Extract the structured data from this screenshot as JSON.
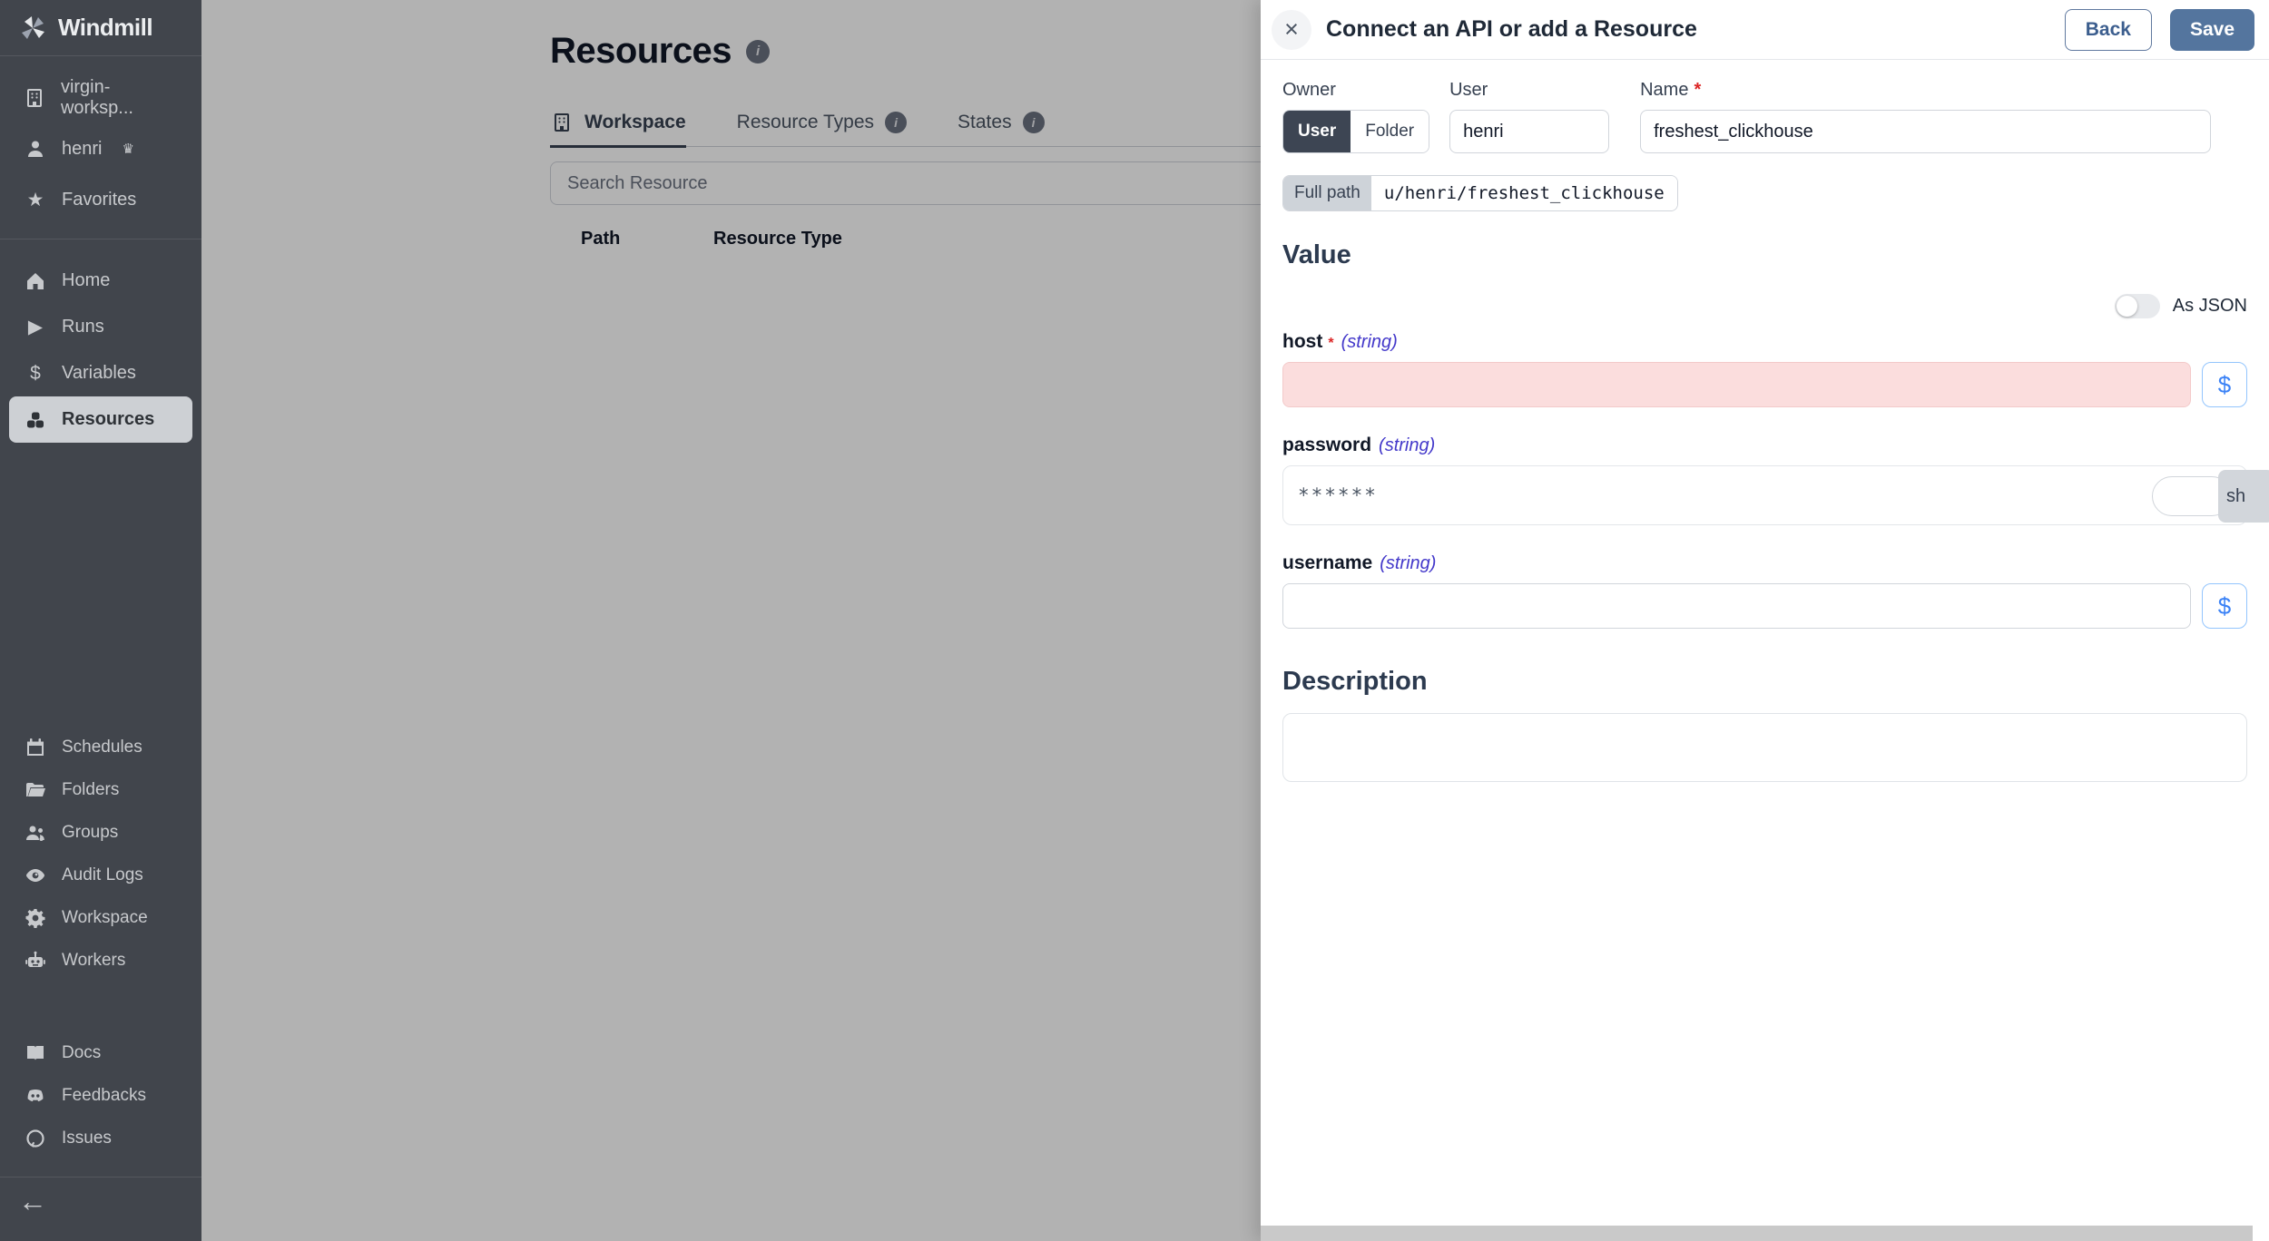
{
  "icons": {
    "close": "×",
    "crown": "♛",
    "star": "★",
    "play": "▶",
    "dollar": "$",
    "arrow_left": "←",
    "info": "i"
  },
  "sidebar": {
    "brand": "Windmill",
    "workspace": "virgin-worksp...",
    "user": "henri",
    "favorites": "Favorites",
    "nav": [
      "Home",
      "Runs",
      "Variables",
      "Resources"
    ],
    "admin": [
      "Schedules",
      "Folders",
      "Groups",
      "Audit Logs",
      "Workspace",
      "Workers"
    ],
    "links": [
      "Docs",
      "Feedbacks",
      "Issues"
    ]
  },
  "main": {
    "title": "Resources",
    "tabs": [
      "Workspace",
      "Resource Types",
      "States"
    ],
    "search_placeholder": "Search Resource",
    "columns": [
      "Path",
      "Resource Type"
    ]
  },
  "drawer": {
    "title": "Connect an API or add a Resource",
    "back": "Back",
    "save": "Save",
    "owner_label": "Owner",
    "owner_options": [
      "User",
      "Folder"
    ],
    "owner_selected": "User",
    "user_label": "User",
    "user_value": "henri",
    "name_label": "Name",
    "required_mark": "*",
    "name_value": "freshest_clickhouse",
    "full_path_label": "Full path",
    "full_path_value": "u/henri/freshest_clickhouse",
    "value_heading": "Value",
    "as_json_label": "As JSON",
    "fields": {
      "host": {
        "name": "host",
        "required": "*",
        "type": "(string)",
        "value": ""
      },
      "password": {
        "name": "password",
        "type": "(string)",
        "value": "******",
        "show_hint": "sh"
      },
      "username": {
        "name": "username",
        "type": "(string)",
        "value": ""
      }
    },
    "dollar_button": "$",
    "description_heading": "Description",
    "description_value": ""
  },
  "colors": {
    "accent": "#54759e",
    "link_blue": "#3b82f6",
    "invalid_bg": "#fbdddd",
    "danger": "#dc2626",
    "sidebar_bg": "#41454c",
    "type_indigo": "#4338ca"
  }
}
